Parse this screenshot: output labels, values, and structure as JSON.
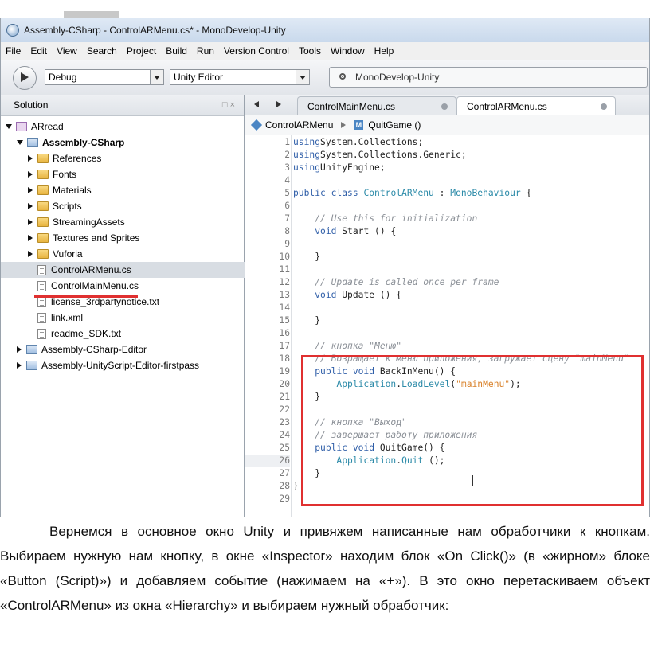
{
  "window": {
    "title": "Assembly-CSharp - ControlARMenu.cs* - MonoDevelop-Unity"
  },
  "menu": [
    "File",
    "Edit",
    "View",
    "Search",
    "Project",
    "Build",
    "Run",
    "Version Control",
    "Tools",
    "Window",
    "Help"
  ],
  "toolbar": {
    "config": "Debug",
    "target": "Unity Editor",
    "status": "MonoDevelop-Unity"
  },
  "solution": {
    "title": "Solution",
    "items": [
      {
        "label": "ARread",
        "depth": 0,
        "kind": "solution",
        "expand": "down"
      },
      {
        "label": "Assembly-CSharp",
        "depth": 1,
        "kind": "project",
        "expand": "down",
        "bold": true
      },
      {
        "label": "References",
        "depth": 2,
        "kind": "folder",
        "expand": "right"
      },
      {
        "label": "Fonts",
        "depth": 2,
        "kind": "folder",
        "expand": "right"
      },
      {
        "label": "Materials",
        "depth": 2,
        "kind": "folder",
        "expand": "right"
      },
      {
        "label": "Scripts",
        "depth": 2,
        "kind": "folder",
        "expand": "right"
      },
      {
        "label": "StreamingAssets",
        "depth": 2,
        "kind": "folder",
        "expand": "right"
      },
      {
        "label": "Textures and Sprites",
        "depth": 2,
        "kind": "folder",
        "expand": "right"
      },
      {
        "label": "Vuforia",
        "depth": 2,
        "kind": "folder",
        "expand": "right"
      },
      {
        "label": "ControlARMenu.cs",
        "depth": 2,
        "kind": "file",
        "expand": "none",
        "selected": true
      },
      {
        "label": "ControlMainMenu.cs",
        "depth": 2,
        "kind": "file",
        "expand": "none"
      },
      {
        "label": "license_3rdpartynotice.txt",
        "depth": 2,
        "kind": "file",
        "expand": "none"
      },
      {
        "label": "link.xml",
        "depth": 2,
        "kind": "file",
        "expand": "none"
      },
      {
        "label": "readme_SDK.txt",
        "depth": 2,
        "kind": "file",
        "expand": "none"
      },
      {
        "label": "Assembly-CSharp-Editor",
        "depth": 1,
        "kind": "project",
        "expand": "right"
      },
      {
        "label": "Assembly-UnityScript-Editor-firstpass",
        "depth": 1,
        "kind": "project",
        "expand": "right"
      }
    ]
  },
  "tabs": [
    {
      "label": "ControlMainMenu.cs",
      "active": false
    },
    {
      "label": "ControlARMenu.cs",
      "active": true
    }
  ],
  "pathbar": {
    "class": "ControlARMenu",
    "method": "QuitGame ()",
    "method_icon": "M"
  },
  "code": [
    [
      [
        "kw",
        "using"
      ],
      [
        "",
        "System.Collections;"
      ]
    ],
    [
      [
        "kw",
        "using"
      ],
      [
        "",
        "System.Collections.Generic;"
      ]
    ],
    [
      [
        "kw",
        "using"
      ],
      [
        "",
        "UnityEngine;"
      ]
    ],
    [],
    [
      [
        "kw",
        "public class"
      ],
      [
        "",
        " "
      ],
      [
        "ty",
        "ControlARMenu"
      ],
      [
        "",
        " : "
      ],
      [
        "ty",
        "MonoBehaviour"
      ],
      [
        "",
        " {"
      ]
    ],
    [],
    [
      [
        "cm",
        "    // Use this for initialization"
      ]
    ],
    [
      [
        "",
        "    "
      ],
      [
        "kw",
        "void"
      ],
      [
        "",
        " Start () {"
      ]
    ],
    [],
    [
      [
        "",
        "    }"
      ]
    ],
    [],
    [
      [
        "cm",
        "    // Update is called once per frame"
      ]
    ],
    [
      [
        "",
        "    "
      ],
      [
        "kw",
        "void"
      ],
      [
        "",
        " Update () {"
      ]
    ],
    [],
    [
      [
        "",
        "    }"
      ]
    ],
    [],
    [
      [
        "cm",
        "    // кнопка \"Меню\""
      ]
    ],
    [
      [
        "cm",
        "    // Возращает к меню приложения, загружает сцену \"mainMenu\""
      ]
    ],
    [
      [
        "",
        "    "
      ],
      [
        "kw",
        "public void"
      ],
      [
        "",
        " BackInMenu() {"
      ]
    ],
    [
      [
        "",
        "        "
      ],
      [
        "mt",
        "Application"
      ],
      [
        "",
        "."
      ],
      [
        "mt",
        "LoadLevel"
      ],
      [
        "",
        "("
      ],
      [
        "st",
        "\"mainMenu\""
      ],
      [
        "",
        ");"
      ]
    ],
    [
      [
        "",
        "    }"
      ]
    ],
    [],
    [
      [
        "cm",
        "    // кнопка \"Выход\""
      ]
    ],
    [
      [
        "cm",
        "    // завершает работу приложения"
      ]
    ],
    [
      [
        "",
        "    "
      ],
      [
        "kw",
        "public void"
      ],
      [
        "",
        " QuitGame() {"
      ]
    ],
    [
      [
        "",
        "        "
      ],
      [
        "mt",
        "Application"
      ],
      [
        "",
        "."
      ],
      [
        "mt",
        "Quit"
      ],
      [
        "",
        " ();"
      ]
    ],
    [
      [
        "",
        "    }"
      ]
    ],
    [
      [
        "",
        "}"
      ]
    ],
    []
  ],
  "current_line": 26,
  "paragraph": "Вернемся в основное окно Unity и привяжем написанные нам обработчики к кнопкам. Выбираем нужную нам кнопку, в окне «Inspector» находим блок «On Click()» (в «жирном» блоке «Button (Script)») и добавляем событие (нажимаем на «+»). В это окно перетаскиваем объект «ControlARMenu» из окна «Hierarchy» и выбираем нужный обработчик:"
}
